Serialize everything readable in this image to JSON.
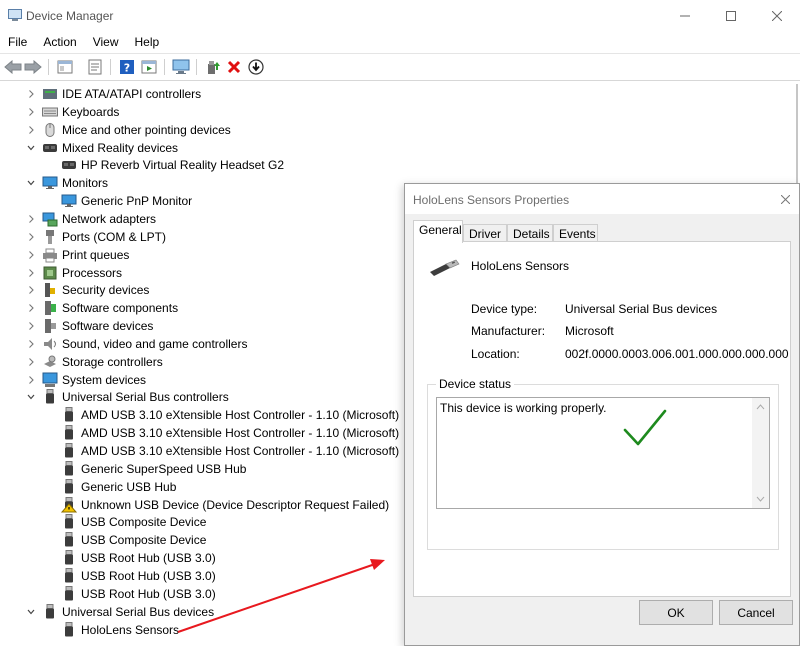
{
  "window": {
    "title": "Device Manager"
  },
  "menu": [
    "File",
    "Action",
    "View",
    "Help"
  ],
  "tree": {
    "items": [
      {
        "label": "IDE ATA/ATAPI controllers",
        "level": 0,
        "expanded": false,
        "icon": "ide-controller-icon"
      },
      {
        "label": "Keyboards",
        "level": 0,
        "expanded": false,
        "icon": "keyboard-icon"
      },
      {
        "label": "Mice and other pointing devices",
        "level": 0,
        "expanded": false,
        "icon": "mouse-icon"
      },
      {
        "label": "Mixed Reality devices",
        "level": 0,
        "expanded": true,
        "icon": "headset-icon"
      },
      {
        "label": "HP Reverb Virtual Reality Headset G2",
        "level": 1,
        "icon": "headset-icon"
      },
      {
        "label": "Monitors",
        "level": 0,
        "expanded": true,
        "icon": "monitor-icon"
      },
      {
        "label": "Generic PnP Monitor",
        "level": 1,
        "icon": "monitor-icon"
      },
      {
        "label": "Network adapters",
        "level": 0,
        "expanded": false,
        "icon": "network-icon"
      },
      {
        "label": "Ports (COM & LPT)",
        "level": 0,
        "expanded": false,
        "icon": "port-icon"
      },
      {
        "label": "Print queues",
        "level": 0,
        "expanded": false,
        "icon": "printer-icon"
      },
      {
        "label": "Processors",
        "level": 0,
        "expanded": false,
        "icon": "processor-icon"
      },
      {
        "label": "Security devices",
        "level": 0,
        "expanded": false,
        "icon": "security-icon"
      },
      {
        "label": "Software components",
        "level": 0,
        "expanded": false,
        "icon": "software-component-icon"
      },
      {
        "label": "Software devices",
        "level": 0,
        "expanded": false,
        "icon": "software-device-icon"
      },
      {
        "label": "Sound, video and game controllers",
        "level": 0,
        "expanded": false,
        "icon": "sound-icon"
      },
      {
        "label": "Storage controllers",
        "level": 0,
        "expanded": false,
        "icon": "storage-icon"
      },
      {
        "label": "System devices",
        "level": 0,
        "expanded": false,
        "icon": "system-icon"
      },
      {
        "label": "Universal Serial Bus controllers",
        "level": 0,
        "expanded": true,
        "icon": "usb-icon"
      },
      {
        "label": "AMD USB 3.10 eXtensible Host Controller - 1.10 (Microsoft)",
        "level": 1,
        "icon": "usb-icon"
      },
      {
        "label": "AMD USB 3.10 eXtensible Host Controller - 1.10 (Microsoft)",
        "level": 1,
        "icon": "usb-icon"
      },
      {
        "label": "AMD USB 3.10 eXtensible Host Controller - 1.10 (Microsoft)",
        "level": 1,
        "icon": "usb-icon"
      },
      {
        "label": "Generic SuperSpeed USB Hub",
        "level": 1,
        "icon": "usb-icon"
      },
      {
        "label": "Generic USB Hub",
        "level": 1,
        "icon": "usb-icon"
      },
      {
        "label": "Unknown USB Device (Device Descriptor Request Failed)",
        "level": 1,
        "icon": "usb-warning-icon"
      },
      {
        "label": "USB Composite Device",
        "level": 1,
        "icon": "usb-icon"
      },
      {
        "label": "USB Composite Device",
        "level": 1,
        "icon": "usb-icon"
      },
      {
        "label": "USB Root Hub (USB 3.0)",
        "level": 1,
        "icon": "usb-icon"
      },
      {
        "label": "USB Root Hub (USB 3.0)",
        "level": 1,
        "icon": "usb-icon"
      },
      {
        "label": "USB Root Hub (USB 3.0)",
        "level": 1,
        "icon": "usb-icon"
      },
      {
        "label": "Universal Serial Bus devices",
        "level": 0,
        "expanded": true,
        "icon": "usb-icon"
      },
      {
        "label": "HoloLens Sensors",
        "level": 1,
        "icon": "usb-icon"
      }
    ]
  },
  "dialog": {
    "title": "HoloLens Sensors Properties",
    "tabs": [
      "General",
      "Driver",
      "Details",
      "Events"
    ],
    "active_tab": "General",
    "device_name": "HoloLens Sensors",
    "properties": [
      {
        "label": "Device type:",
        "value": "Universal Serial Bus devices"
      },
      {
        "label": "Manufacturer:",
        "value": "Microsoft"
      },
      {
        "label": "Location:",
        "value": "002f.0000.0003.006.001.000.000.000.000"
      }
    ],
    "status_group_label": "Device status",
    "status_text": "This device is working properly.",
    "ok_label": "OK",
    "cancel_label": "Cancel"
  },
  "colors": {
    "annotation_arrow": "#e8191f",
    "check_mark": "#1e8a1e",
    "help_icon": "#1f5fbf",
    "delete_icon": "#e01010"
  }
}
